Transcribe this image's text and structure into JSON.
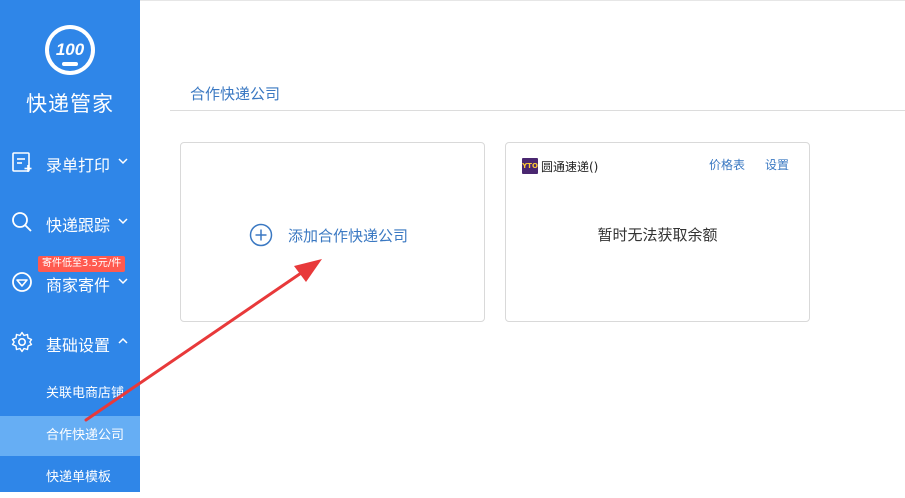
{
  "app": {
    "brand": "快递管家",
    "logo_text": "100"
  },
  "sidebar": {
    "items": [
      {
        "label": "录单打印",
        "icon": "order-entry-icon",
        "chevron": "down"
      },
      {
        "label": "快递跟踪",
        "icon": "search-icon",
        "chevron": "down"
      },
      {
        "label": "商家寄件",
        "icon": "merchant-icon",
        "chevron": "down",
        "badge": "寄件低至3.5元/件"
      },
      {
        "label": "基础设置",
        "icon": "gear-icon",
        "chevron": "up"
      }
    ],
    "sub_items": [
      {
        "label": "关联电商店铺",
        "active": false
      },
      {
        "label": "合作快递公司",
        "active": true
      },
      {
        "label": "快递单模板",
        "active": false
      }
    ]
  },
  "main": {
    "title": "合作快递公司",
    "add_card": {
      "label": "添加合作快递公司",
      "icon": "plus-circle-icon"
    },
    "company_card": {
      "logo_text": "YTO",
      "name": "圆通速递()",
      "price_link": "价格表",
      "settings_link": "设置",
      "message": "暂时无法获取余额"
    }
  },
  "colors": {
    "sidebar_bg": "#2f86e8",
    "active_item": "#66aef4",
    "accent": "#3a78c2",
    "arrow": "#e8393a",
    "badge": "#ff5a4f"
  }
}
